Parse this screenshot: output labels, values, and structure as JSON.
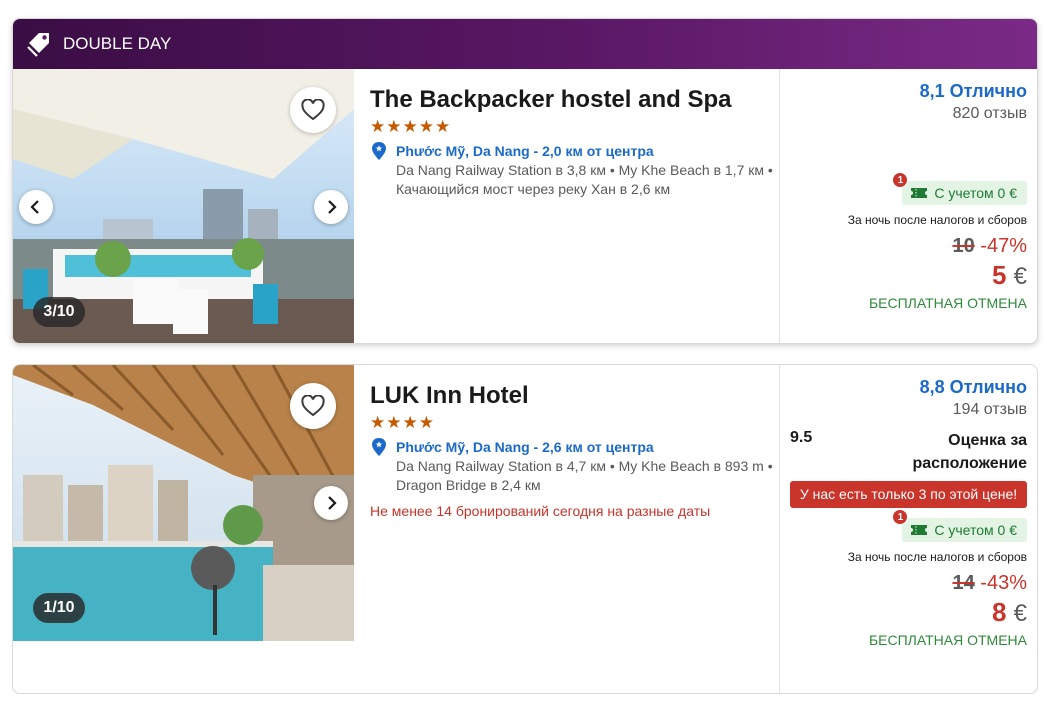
{
  "listings": [
    {
      "promo_banner": "DOUBLE DAY",
      "photo_counter": "3/10",
      "name": "The Backpacker hostel and Spa",
      "stars": "★★★★★",
      "location": "Phước Mỹ, Da Nang - 2,0 км от центра",
      "landmarks": "Da Nang Railway Station в 3,8 км • My Khe Beach в 1,7 км • Качающийся мост через реку Хан в 2,6 км",
      "rating": "8,1 Отлично",
      "reviews": "820 отзыв",
      "tax_notif": "1",
      "tax_badge": "С учетом 0 €",
      "price_note": "За ночь после налогов и сборов",
      "old_price": "10",
      "discount": "-47%",
      "new_price": "5",
      "currency": "€",
      "cancellation": "БЕСПЛАТНАЯ ОТМЕНА"
    },
    {
      "photo_counter": "1/10",
      "name": "LUK Inn Hotel",
      "stars": "★★★★",
      "location": "Phước Mỹ, Da Nang - 2,6 км от центра",
      "landmarks": "Da Nang Railway Station в 4,7 км • My Khe Beach в 893 m • Dragon Bridge в 2,4 км",
      "urgency": "Не менее 14 бронирований сегодня на разные даты",
      "rating": "8,8 Отлично",
      "reviews": "194 отзыв",
      "location_score": "9.5",
      "location_score_label": "Оценка за расположение",
      "alert": "У нас есть только 3 по этой цене!",
      "tax_notif": "1",
      "tax_badge": "С учетом 0 €",
      "price_note": "За ночь после налогов и сборов",
      "old_price": "14",
      "discount": "-43%",
      "new_price": "8",
      "currency": "€",
      "cancellation": "БЕСПЛАТНАЯ ОТМЕНА"
    }
  ],
  "colors": {
    "banner_start": "#3a0d44",
    "banner_end": "#7a2a86",
    "rating_blue": "#1b6ac9",
    "price_red": "#c9342b",
    "cancel_green": "#2f8a3a",
    "stars_orange": "#c65a00"
  },
  "icons": [
    "tag-icon",
    "heart-icon",
    "chevron-left-icon",
    "chevron-right-icon",
    "location-pin-icon",
    "ticket-icon"
  ]
}
